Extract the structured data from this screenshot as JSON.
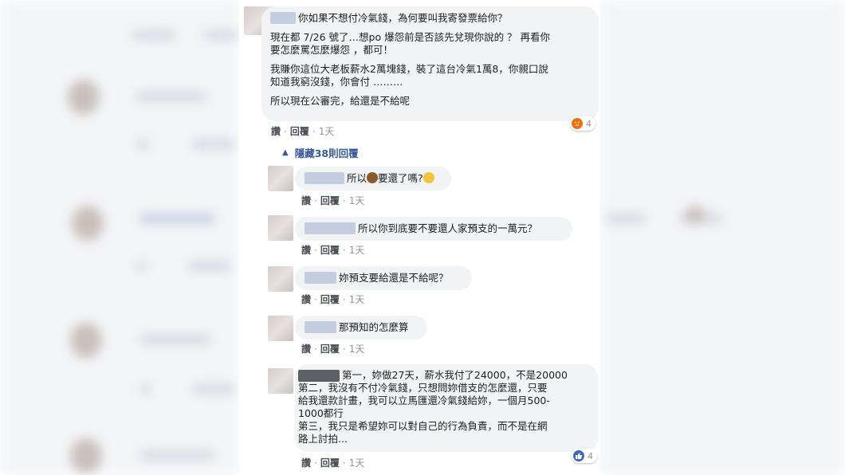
{
  "colors": {
    "link": "#385898",
    "bubble": "#f2f3f5",
    "angry": "#e9710f",
    "like": "#4267b2"
  },
  "main_comment": {
    "line1": "你如果不想付冷氣錢，為何要叫我寄發票給你？",
    "para2": "現在都 7/26 號了…想po 爆怨前是否該先兌現你說的 ？ 再看你\n要怎麼罵怎麼爆怨 ，都可！",
    "para3": "我賺你這位大老板薪水2萬塊錢，裝了這台冷氣1萬8，你親口說\n知道我窮沒錢，你會付 ………",
    "para4": "所以現在公審完，給還是不給呢",
    "like": "讚",
    "reply": "回覆",
    "time": "1天",
    "reaction_icon": "angry-icon",
    "reaction_count": "4"
  },
  "hidden_replies": {
    "label": "隱藏38則回覆",
    "icon": "chevron-up-icon"
  },
  "replies": [
    {
      "pre": "所以",
      "emoji": "money-bag-icon",
      "post": "要還了嗎?",
      "emoji2": "raised-hands-icon",
      "like": "讚",
      "reply": "回覆",
      "time": "1天"
    },
    {
      "text": "所以你到底要不要還人家預支的一萬元？",
      "like": "讚",
      "reply": "回覆",
      "time": "1天"
    },
    {
      "text": "妳預支要給還是不給呢？",
      "like": "讚",
      "reply": "回覆",
      "time": "1天"
    },
    {
      "text": "那預知的怎麼算",
      "like": "讚",
      "reply": "回覆",
      "time": "1天"
    }
  ],
  "last_reply": {
    "text": "第一，妳做27天，薪水我付了24000，不是20000\n第二，我沒有不付冷氣錢，只想問妳借支的怎麼還，只要\n給我還款計畫，我可以立馬匯還冷氣錢給妳，一個月500-\n1000都行\n第三，我只是希望妳可以對自己的行為負責，而不是在網\n路上討拍...",
    "like": "讚",
    "reply": "回覆",
    "time": "1天",
    "reaction_icon": "like-icon",
    "reaction_count": "4"
  }
}
